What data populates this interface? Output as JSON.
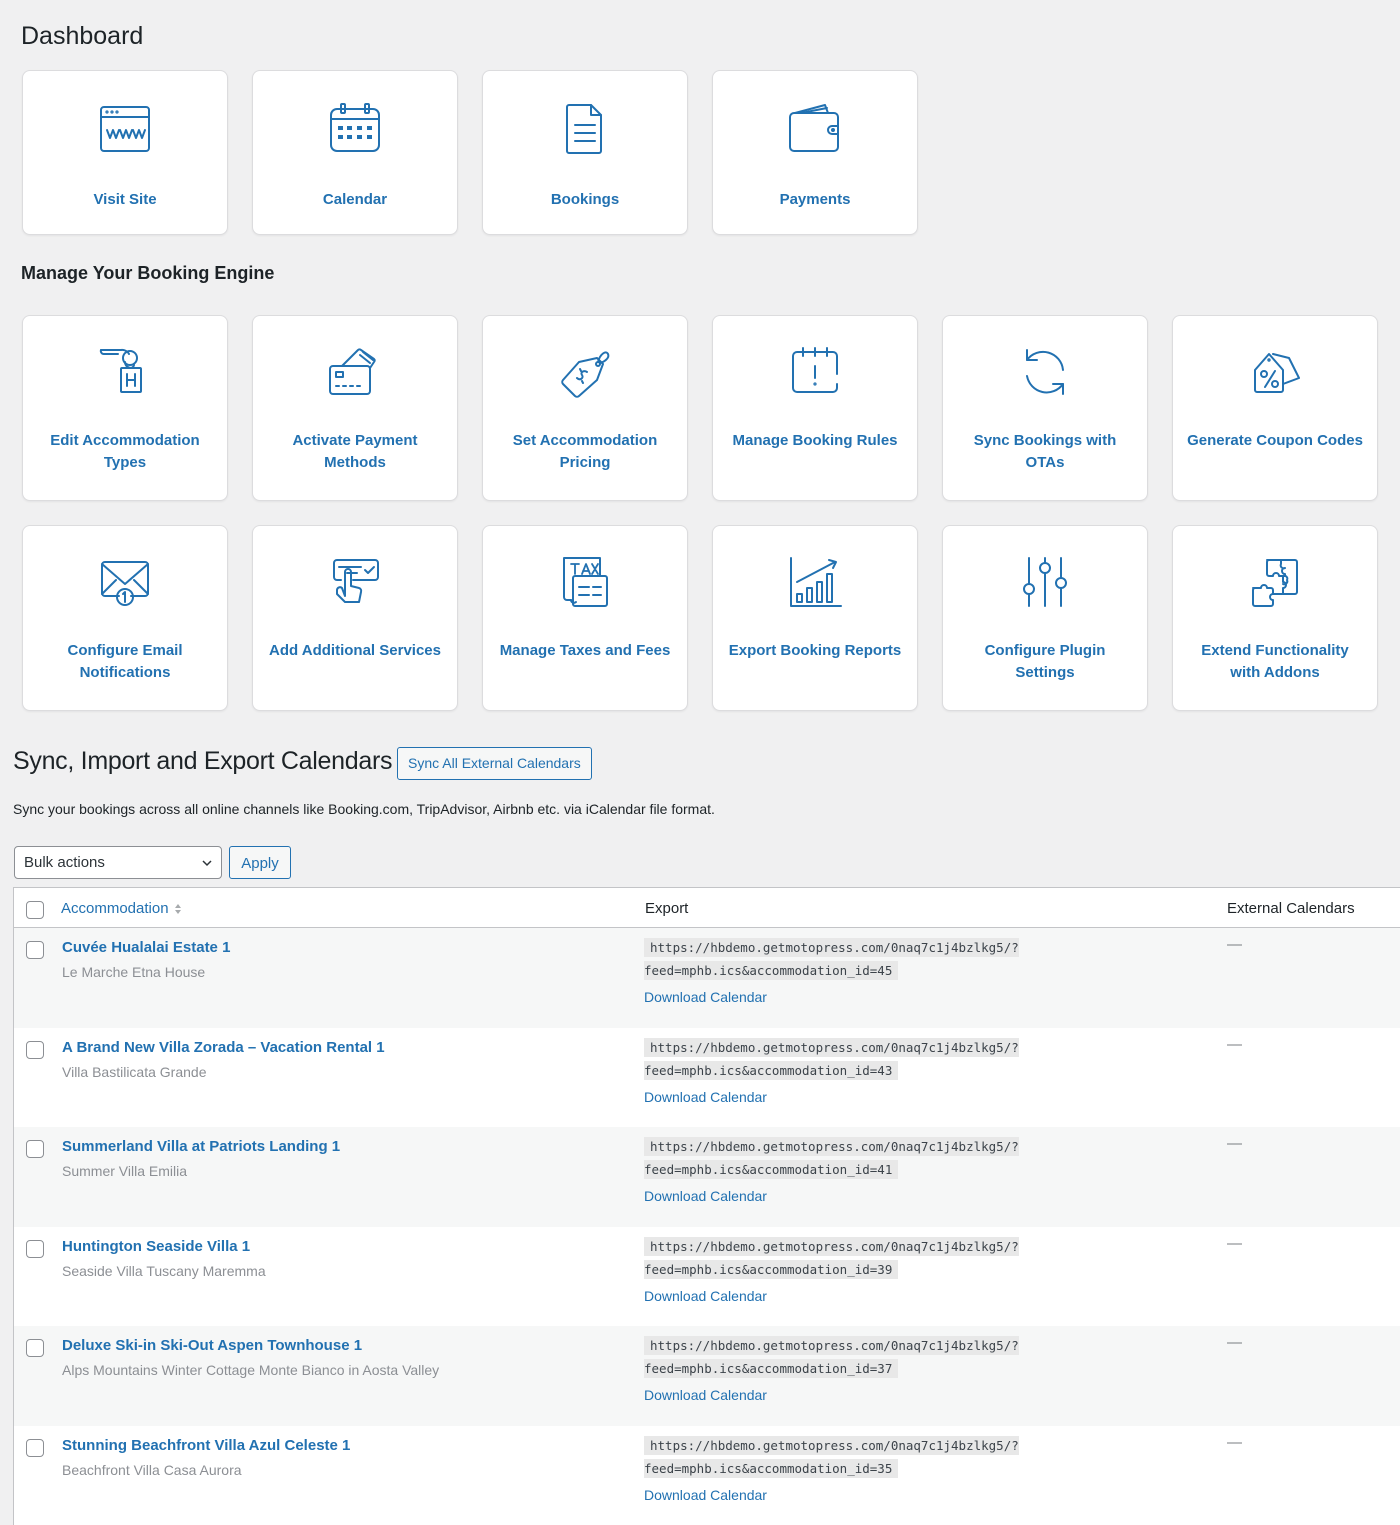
{
  "dashboard": {
    "title": "Dashboard",
    "cards": [
      {
        "label": "Visit Site",
        "icon": "browser-www-icon"
      },
      {
        "label": "Calendar",
        "icon": "calendar-icon"
      },
      {
        "label": "Bookings",
        "icon": "document-icon"
      },
      {
        "label": "Payments",
        "icon": "wallet-icon"
      }
    ]
  },
  "manage": {
    "title": "Manage Your Booking Engine",
    "cards": [
      {
        "label": "Edit Accommodation Types",
        "icon": "hotel-key-icon"
      },
      {
        "label": "Activate Payment Methods",
        "icon": "credit-card-icon"
      },
      {
        "label": "Set Accommodation Pricing",
        "icon": "price-tag-icon"
      },
      {
        "label": "Manage Booking Rules",
        "icon": "calendar-alert-icon"
      },
      {
        "label": "Sync Bookings with OTAs",
        "icon": "sync-icon"
      },
      {
        "label": "Generate Coupon Codes",
        "icon": "coupon-tag-icon"
      },
      {
        "label": "Configure Email Notifications",
        "icon": "email-notification-icon"
      },
      {
        "label": "Add Additional Services",
        "icon": "touch-service-icon"
      },
      {
        "label": "Manage Taxes and Fees",
        "icon": "tax-document-icon"
      },
      {
        "label": "Export Booking Reports",
        "icon": "growth-chart-icon"
      },
      {
        "label": "Configure Plugin Settings",
        "icon": "sliders-icon"
      },
      {
        "label": "Extend Functionality with Addons",
        "icon": "puzzle-icon"
      }
    ]
  },
  "sync": {
    "title": "Sync, Import and Export Calendars",
    "sync_all_label": "Sync All External Calendars",
    "description": "Sync your bookings across all online channels like Booking.com, TripAdvisor, Airbnb etc. via iCalendar file format.",
    "bulk_actions": {
      "selected": "Bulk actions"
    },
    "apply_label": "Apply",
    "table": {
      "columns": [
        "Accommodation",
        "Export",
        "External Calendars"
      ],
      "download_label": "Download Calendar",
      "rows": [
        {
          "name": "Cuvée Hualalai Estate 1",
          "type": "Le Marche Etna House",
          "url_line1": "https://hbdemo.getmotopress.com/0naq7c1j4bzlkg5/?",
          "url_line2": "feed=mphb.ics&accommodation_id=45",
          "external": "—"
        },
        {
          "name": "A Brand New Villa Zorada – Vacation Rental 1",
          "type": "Villa Bastilicata Grande",
          "url_line1": "https://hbdemo.getmotopress.com/0naq7c1j4bzlkg5/?",
          "url_line2": "feed=mphb.ics&accommodation_id=43",
          "external": "—"
        },
        {
          "name": "Summerland Villa at Patriots Landing 1",
          "type": "Summer Villa Emilia",
          "url_line1": "https://hbdemo.getmotopress.com/0naq7c1j4bzlkg5/?",
          "url_line2": "feed=mphb.ics&accommodation_id=41",
          "external": "—"
        },
        {
          "name": "Huntington Seaside Villa 1",
          "type": "Seaside Villa Tuscany Maremma",
          "url_line1": "https://hbdemo.getmotopress.com/0naq7c1j4bzlkg5/?",
          "url_line2": "feed=mphb.ics&accommodation_id=39",
          "external": "—"
        },
        {
          "name": "Deluxe Ski-in Ski-Out Aspen Townhouse 1",
          "type": "Alps Mountains Winter Cottage Monte Bianco in Aosta Valley",
          "url_line1": "https://hbdemo.getmotopress.com/0naq7c1j4bzlkg5/?",
          "url_line2": "feed=mphb.ics&accommodation_id=37",
          "external": "—"
        },
        {
          "name": "Stunning Beachfront Villa Azul Celeste 1",
          "type": "Beachfront Villa Casa Aurora",
          "url_line1": "https://hbdemo.getmotopress.com/0naq7c1j4bzlkg5/?",
          "url_line2": "feed=mphb.ics&accommodation_id=35",
          "external": "—"
        }
      ]
    }
  },
  "colors": {
    "accent": "#2271b1",
    "background": "#f0f0f1",
    "text": "#1d2327",
    "muted": "#8c8f94"
  }
}
